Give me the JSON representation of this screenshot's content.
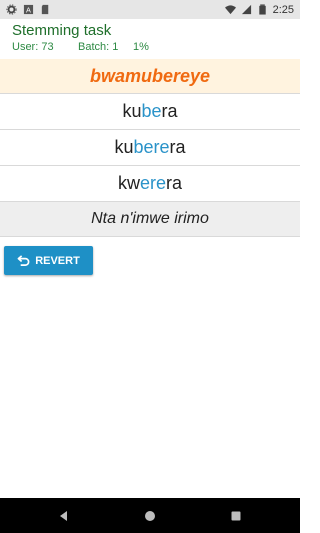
{
  "status_bar": {
    "time": "2:25",
    "icons": [
      "settings-icon",
      "text-icon",
      "sd-card-icon",
      "wifi-icon",
      "signal-icon",
      "battery-icon"
    ]
  },
  "header": {
    "title": "Stemming task",
    "user": "User: 73",
    "batch": "Batch: 1",
    "progress": "1%"
  },
  "target_word": "bwamubereye",
  "options": [
    {
      "parts": [
        {
          "text": "ku",
          "hl": false
        },
        {
          "text": "be",
          "hl": true
        },
        {
          "text": "ra",
          "hl": false
        }
      ]
    },
    {
      "parts": [
        {
          "text": "ku",
          "hl": false
        },
        {
          "text": "bere",
          "hl": true
        },
        {
          "text": "r",
          "hl": false
        },
        {
          "text": "a",
          "hl": false
        }
      ]
    },
    {
      "parts": [
        {
          "text": "kw",
          "hl": false
        },
        {
          "text": "ere",
          "hl": true
        },
        {
          "text": "r",
          "hl": false
        },
        {
          "text": "a",
          "hl": false
        }
      ]
    }
  ],
  "none_option": "Nta n'imwe irimo",
  "revert_button": {
    "label": "REVERT",
    "icon": "undo-icon"
  },
  "nav_bar": {
    "icons": [
      "back-icon",
      "home-icon",
      "recents-icon"
    ]
  },
  "colors": {
    "title": "#1f6f2b",
    "target_bg": "#fff3df",
    "target_text": "#f06a11",
    "highlight": "#2a93c9",
    "button": "#1e90c6"
  }
}
